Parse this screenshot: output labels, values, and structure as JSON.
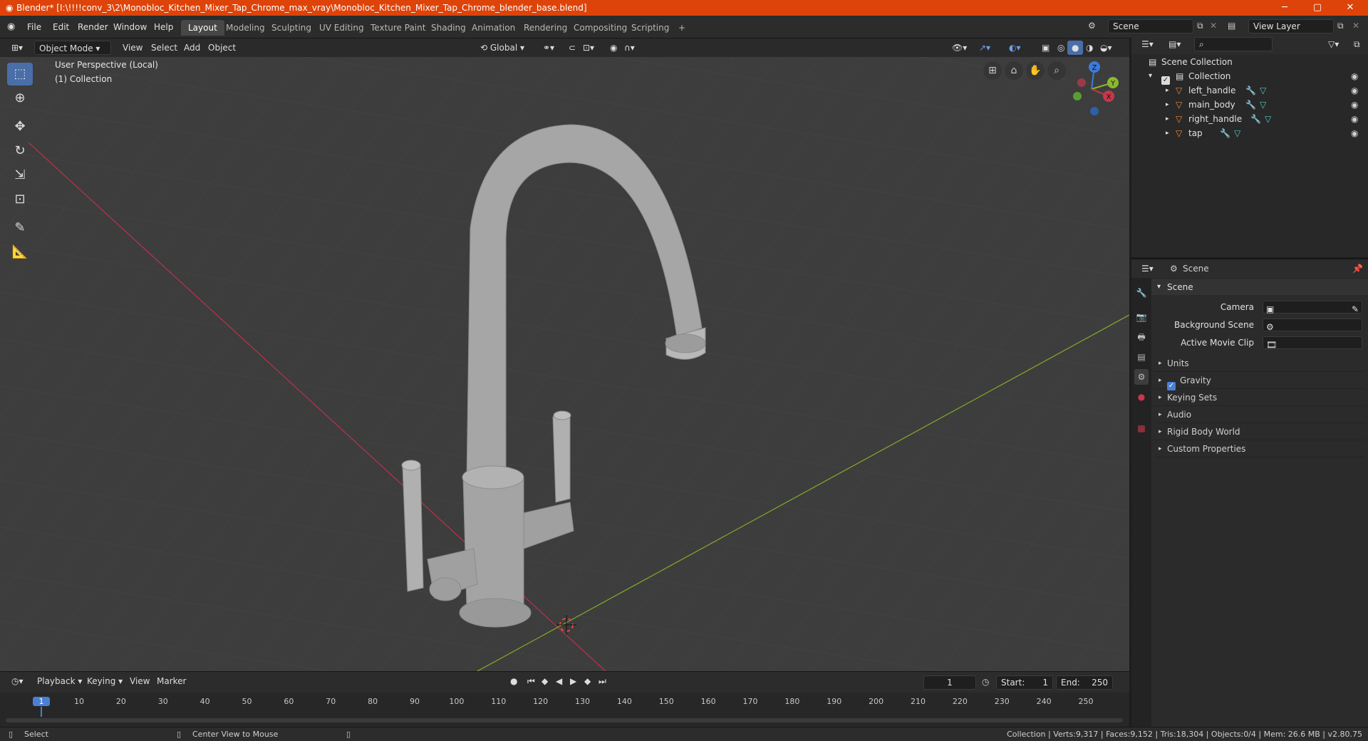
{
  "window": {
    "title": "Blender* [I:\\!!!!conv_3\\2\\Monobloc_Kitchen_Mixer_Tap_Chrome_max_vray\\Monobloc_Kitchen_Mixer_Tap_Chrome_blender_base.blend]",
    "minimize": "─",
    "maximize": "▢",
    "close": "✕"
  },
  "menu": [
    "File",
    "Edit",
    "Render",
    "Window",
    "Help"
  ],
  "workspaces": [
    "Layout",
    "Modeling",
    "Sculpting",
    "UV Editing",
    "Texture Paint",
    "Shading",
    "Animation",
    "Rendering",
    "Compositing",
    "Scripting",
    "+"
  ],
  "active_workspace": "Layout",
  "scene_field": "Scene",
  "view_layer_field": "View Layer",
  "viewport_header": {
    "mode": "Object Mode",
    "menus": [
      "View",
      "Select",
      "Add",
      "Object"
    ],
    "transform_orientation": "Global"
  },
  "viewport": {
    "perspective_label": "User Perspective (Local)",
    "collection_label": "(1) Collection",
    "gizmo_axes": [
      "Z",
      "Y",
      "X"
    ]
  },
  "outliner": {
    "root": "Scene Collection",
    "collection": "Collection",
    "objects": [
      "left_handle",
      "main_body",
      "right_handle",
      "tap"
    ]
  },
  "properties": {
    "context": "Scene",
    "panel_title": "Scene",
    "fields": [
      {
        "label": "Camera"
      },
      {
        "label": "Background Scene"
      },
      {
        "label": "Active Movie Clip"
      }
    ],
    "subpanels": [
      "Units",
      "Gravity",
      "Keying Sets",
      "Audio",
      "Rigid Body World",
      "Custom Properties"
    ]
  },
  "timeline": {
    "menus": [
      "Playback",
      "Keying",
      "View",
      "Marker"
    ],
    "current_frame": "1",
    "start_label": "Start:",
    "start": "1",
    "end_label": "End:",
    "end": "250",
    "ticks": [
      "1",
      "10",
      "20",
      "30",
      "40",
      "50",
      "60",
      "70",
      "80",
      "90",
      "100",
      "110",
      "120",
      "130",
      "140",
      "150",
      "160",
      "170",
      "180",
      "190",
      "200",
      "210",
      "220",
      "230",
      "240",
      "250"
    ]
  },
  "statusbar": {
    "left": "Select",
    "middle": "Center View to Mouse",
    "right": "Collection | Verts:9,317 | Faces:9,152 | Tris:18,304 | Objects:0/4 | Mem: 26.6 MB | v2.80.75"
  },
  "colors": {
    "titlebar": "#de4309",
    "accent": "#4a6ea8",
    "viewport_bg": "#3d3d3d",
    "x_axis": "#c8374a",
    "y_axis": "#8bb82c",
    "z_axis": "#3b7bdb"
  }
}
